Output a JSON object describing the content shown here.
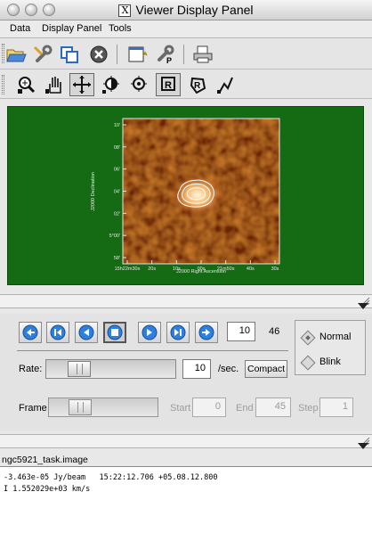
{
  "window": {
    "title": "Viewer Display Panel",
    "x_badge": "X"
  },
  "menu": [
    {
      "label": "Data",
      "key": "D"
    },
    {
      "label": "Display Panel",
      "key": "i"
    },
    {
      "label": "Tools",
      "key": "T"
    }
  ],
  "toolbar_icons": [
    "open-folder-icon",
    "wrench-icon",
    "copy-panel-icon",
    "close-panel-icon",
    "new-display-icon",
    "print-setup-icon",
    "printer-icon"
  ],
  "mouse_tools": [
    "zoom-icon",
    "pan-icon",
    "crosshair-icon",
    "contrast-icon",
    "position-icon",
    "rectangle-region-icon",
    "polygon-region-icon",
    "polyline-icon"
  ],
  "plot": {
    "ylabel": "J2000 Declination",
    "xlabel": "J2000 Right Ascension",
    "y_ticks": [
      "10'",
      "08'",
      "06'",
      "04'",
      "02'",
      "5°00'",
      "58'"
    ],
    "x_ticks": [
      "15h22m30s",
      "20s",
      "10s",
      "00s",
      "21m50s",
      "40s",
      "30s"
    ]
  },
  "animator": {
    "frame_value": "10",
    "frame_count": "46",
    "rate_label": "Rate:",
    "rate_value": "10",
    "rate_unit": "/sec.",
    "compact_label": "Compact",
    "frame_label": "Frame",
    "start_label": "Start",
    "start_value": "0",
    "end_label": "End",
    "end_value": "45",
    "step_label": "Step",
    "step_value": "1",
    "mode_normal": "Normal",
    "mode_blink": "Blink",
    "selected_mode": "Normal"
  },
  "tracking": {
    "image_name": "ngc5921_task.image",
    "line1": "-3.463e-05 Jy/beam   15:22:12.706 +05.08.12.800",
    "line2": "I 1.552029e+03 km/s"
  },
  "colors": {
    "canvas_bg": "#146b14",
    "image_base": "#7a2a05",
    "contour": "#ffffff"
  }
}
